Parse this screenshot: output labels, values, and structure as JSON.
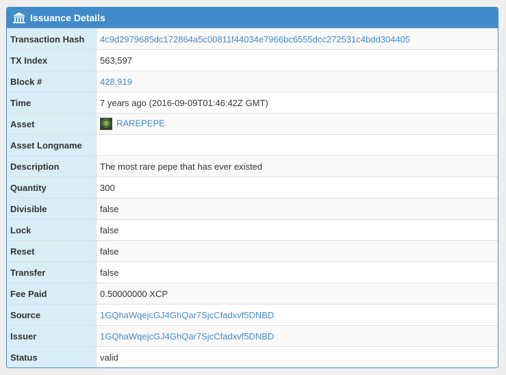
{
  "panel": {
    "title": "Issuance Details",
    "icon": "bank-icon"
  },
  "rows": {
    "tx_hash": {
      "label": "Transaction Hash",
      "value": "4c9d2979685dc172864a5c00811f44034e7966bc6555dcc272531c4bdd304405"
    },
    "tx_index": {
      "label": "TX Index",
      "value": "563,597"
    },
    "block": {
      "label": "Block #",
      "value": "428,919"
    },
    "time": {
      "label": "Time",
      "value": "7 years ago (2016-09-09T01:46:42Z GMT)"
    },
    "asset": {
      "label": "Asset",
      "value": "RAREPEPE"
    },
    "asset_longname": {
      "label": "Asset Longname",
      "value": ""
    },
    "description": {
      "label": "Description",
      "value": "The most rare pepe that has ever existed"
    },
    "quantity": {
      "label": "Quantity",
      "value": "300"
    },
    "divisible": {
      "label": "Divisible",
      "value": "false"
    },
    "lock": {
      "label": "Lock",
      "value": "false"
    },
    "reset": {
      "label": "Reset",
      "value": "false"
    },
    "transfer": {
      "label": "Transfer",
      "value": "false"
    },
    "fee_paid": {
      "label": "Fee Paid",
      "value": "0.50000000 XCP"
    },
    "source": {
      "label": "Source",
      "value": "1GQhaWqejcGJ4GhQar7SjcCfadxvf5DNBD"
    },
    "issuer": {
      "label": "Issuer",
      "value": "1GQhaWqejcGJ4GhQar7SjcCfadxvf5DNBD"
    },
    "status": {
      "label": "Status",
      "value": "valid"
    }
  },
  "colors": {
    "header": "#428bca",
    "label_bg": "#d9edf7",
    "link": "#428bca"
  }
}
